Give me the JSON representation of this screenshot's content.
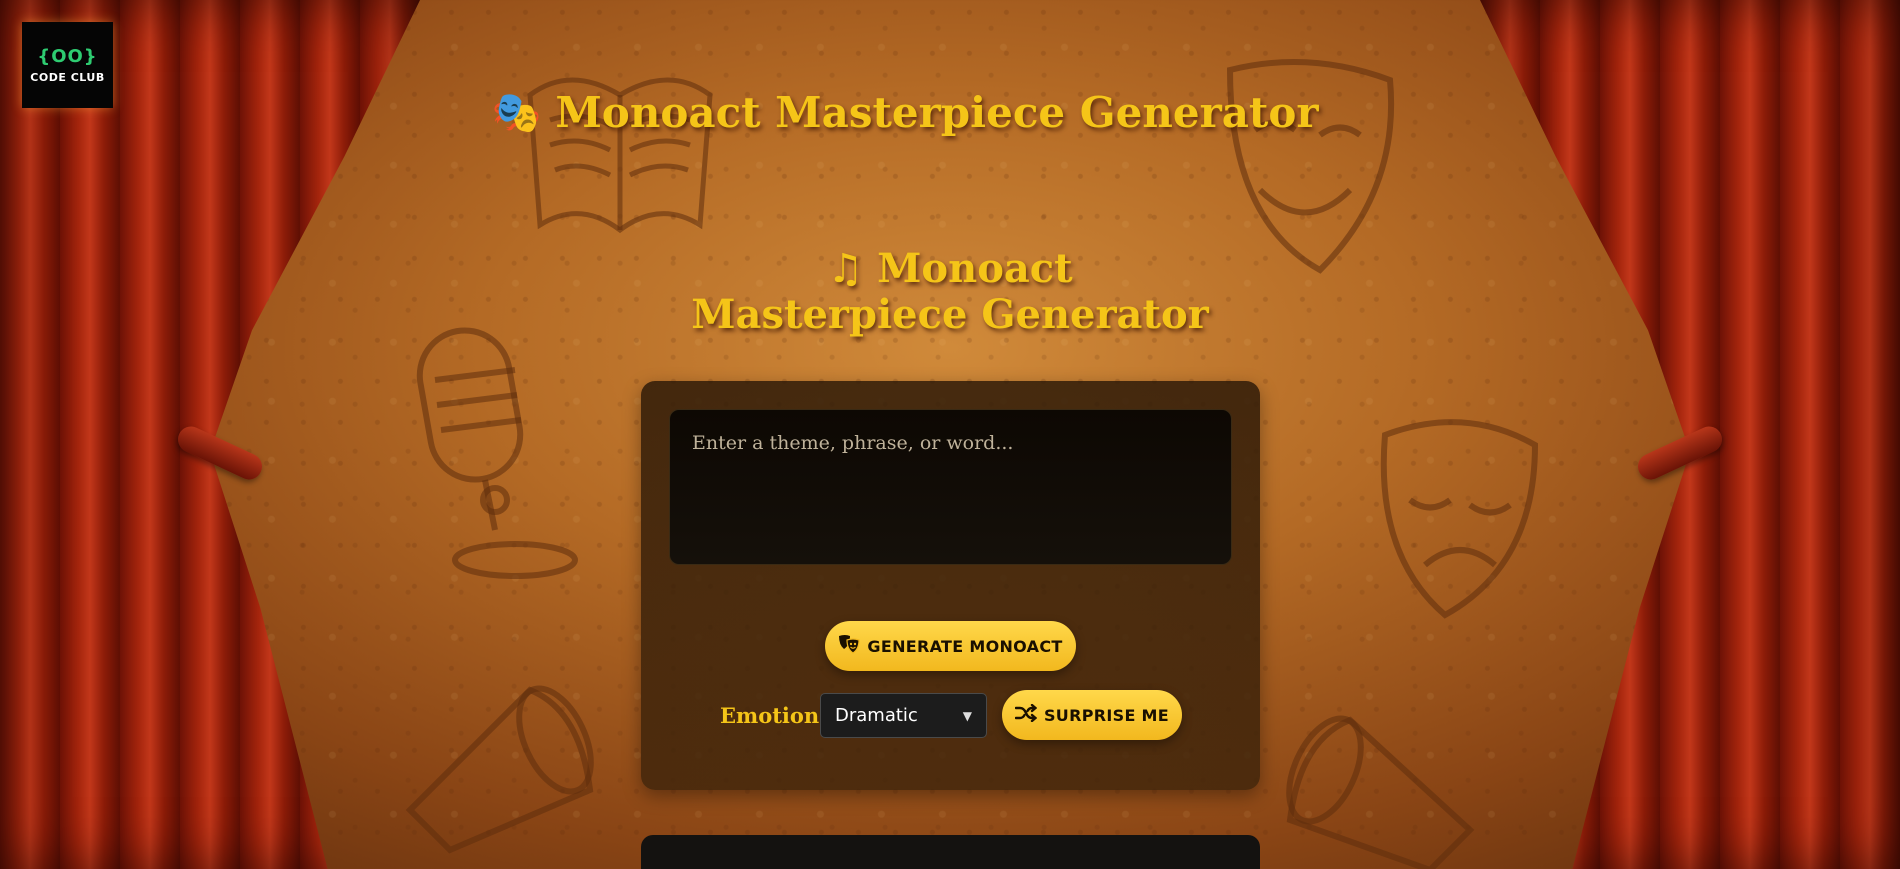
{
  "logo": {
    "mark": "{OO}",
    "text": "CODE CLUB"
  },
  "header": {
    "emoji": "🎭",
    "title": "Monoact Masterpiece Generator"
  },
  "subheader": {
    "emoji": "♫",
    "title": "Monoact Masterpiece Generator"
  },
  "input": {
    "placeholder": "Enter a theme, phrase, or word...",
    "value": ""
  },
  "buttons": {
    "generate_label": "GENERATE MONOACT",
    "generate_icon": "theater-masks-icon",
    "surprise_label": "SURPRISE ME",
    "surprise_icon": "shuffle-icon"
  },
  "emotion": {
    "label": "Emotion:",
    "selected": "Dramatic"
  },
  "colors": {
    "accent_gold": "#f5c518",
    "button_gold": "#ffd84a",
    "panel_dark": "#2a1606",
    "curtain_red": "#a3240c"
  }
}
